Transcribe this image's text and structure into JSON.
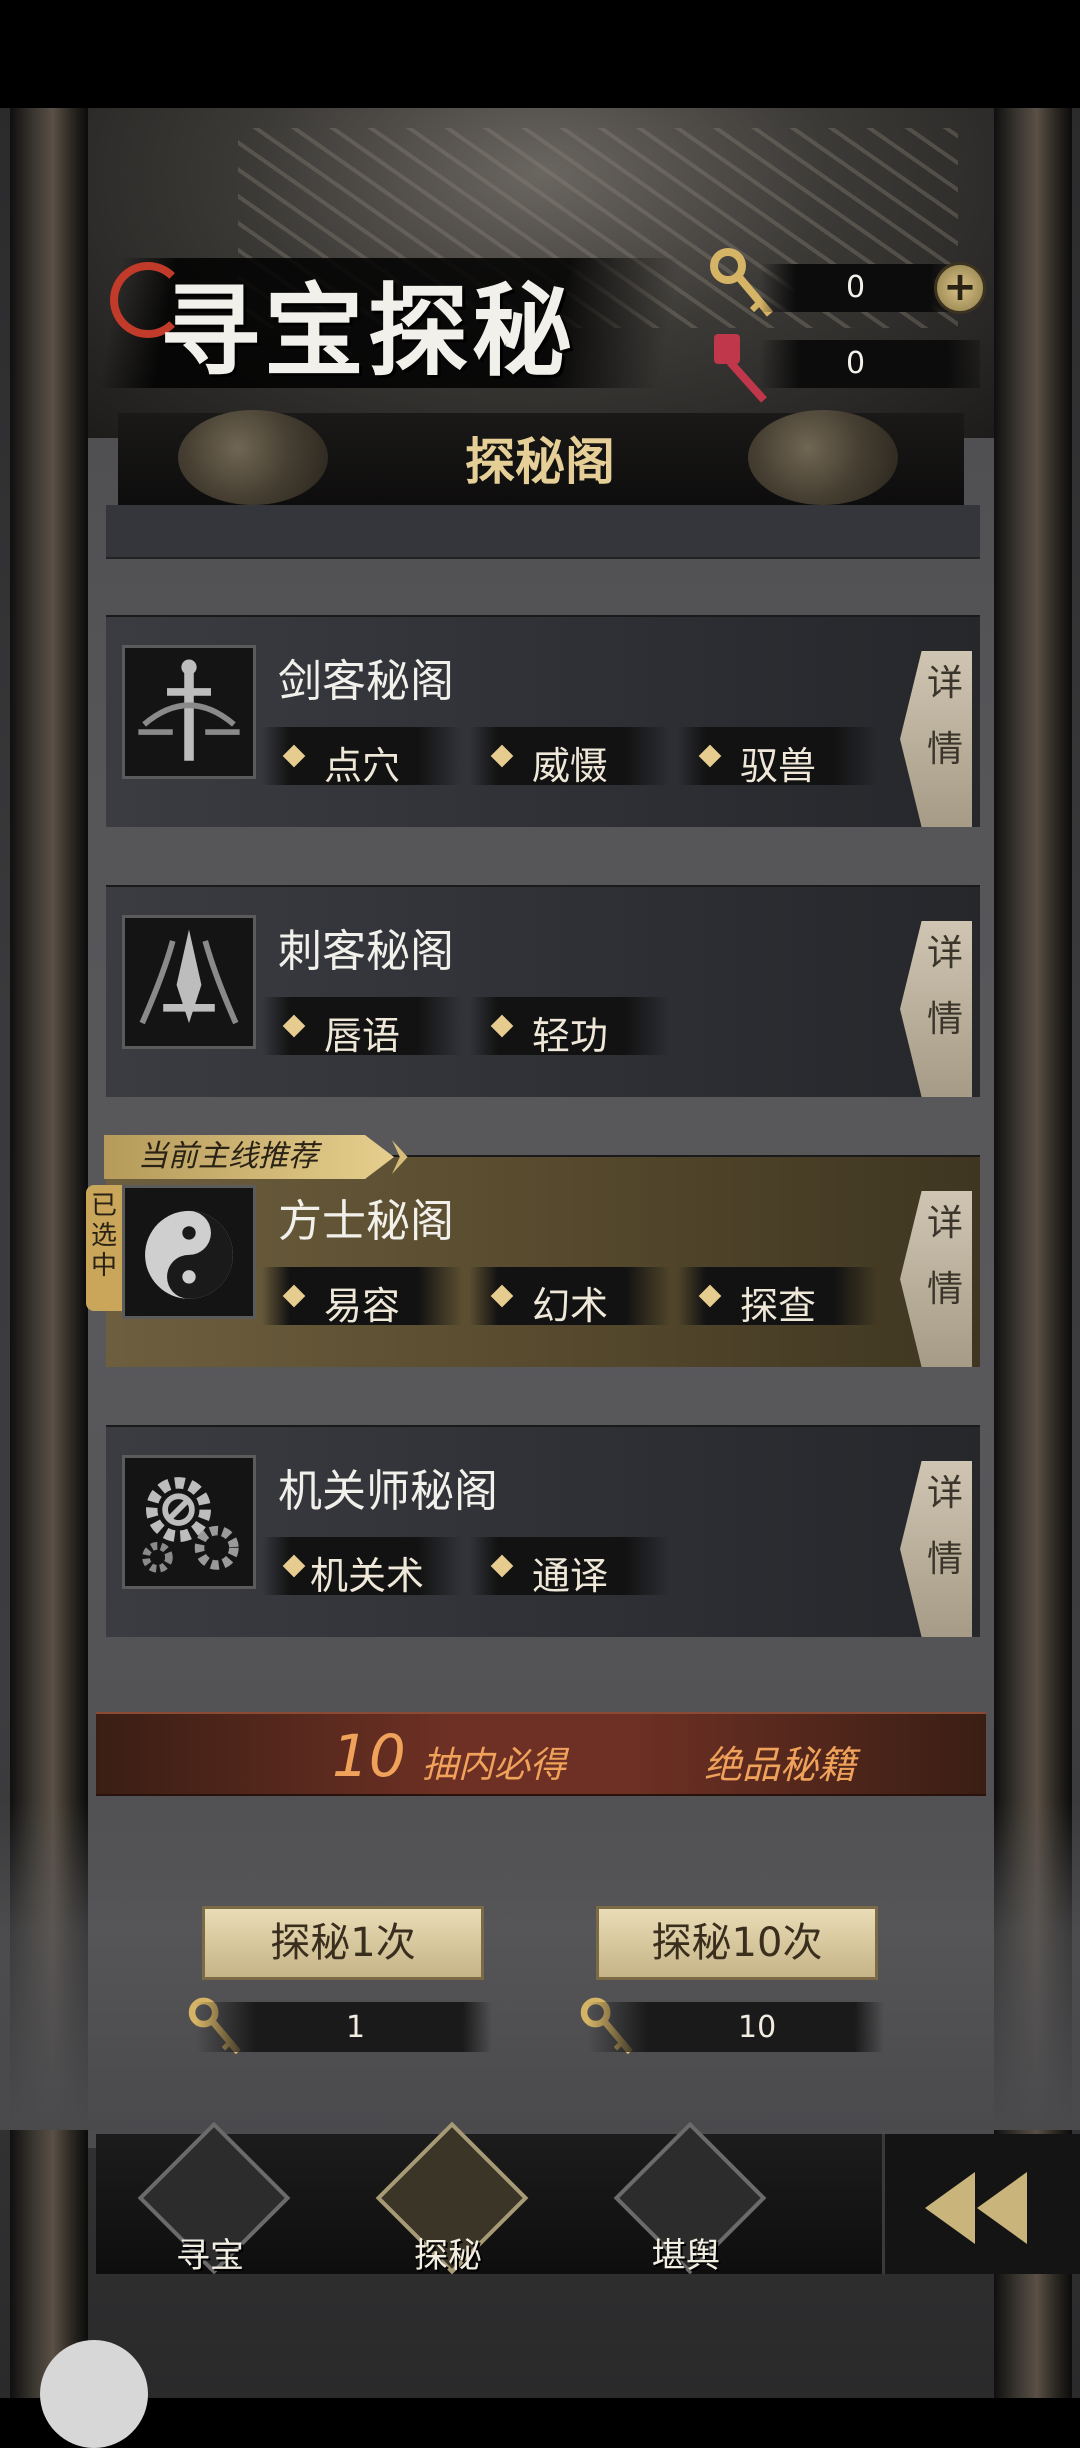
{
  "header": {
    "title": "寻宝探秘",
    "subtitle": "探秘阁",
    "gold_keys": "0",
    "red_keys": "0",
    "add_icon": "plus-icon"
  },
  "cards": [
    {
      "title": "剑客秘阁",
      "tags": [
        "点穴",
        "威慑",
        "驭兽"
      ],
      "detail": [
        "详",
        "情"
      ],
      "icon": "sword-emblem-icon"
    },
    {
      "title": "刺客秘阁",
      "tags": [
        "唇语",
        "轻功"
      ],
      "detail": [
        "详",
        "情"
      ],
      "icon": "dagger-emblem-icon"
    },
    {
      "title": "方士秘阁",
      "tags": [
        "易容",
        "幻术",
        "探查"
      ],
      "detail": [
        "详",
        "情"
      ],
      "icon": "yin-yang-icon",
      "recommend_badge": "当前主线推荐",
      "selected_badge": "已选中"
    },
    {
      "title": "机关师秘阁",
      "tags": [
        "机关术",
        "通译"
      ],
      "detail": [
        "详",
        "情"
      ],
      "icon": "gears-icon"
    }
  ],
  "banner": {
    "number": "10",
    "text1": "抽内必得",
    "text2": "绝品秘籍"
  },
  "draw": {
    "once_label": "探秘1次",
    "once_cost": "1",
    "ten_label": "探秘10次",
    "ten_cost": "10"
  },
  "nav": [
    {
      "label": "寻宝",
      "icon": "treasure-bag-icon"
    },
    {
      "label": "探秘",
      "icon": "chest-icon",
      "active": true
    },
    {
      "label": "堪舆",
      "icon": "scroll-icon"
    }
  ],
  "colors": {
    "accent": "#e6cf97",
    "selected": "#6d5f3e",
    "banner": "#6e3024"
  }
}
